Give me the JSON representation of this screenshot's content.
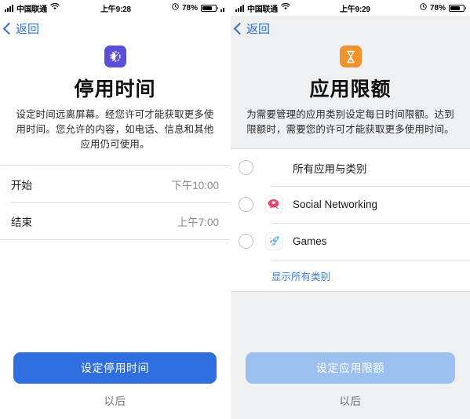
{
  "left": {
    "statusbar": {
      "carrier": "中国联通",
      "time": "上午9:28",
      "battery_pct": "78%",
      "signal_icon": "cellular-signal-icon",
      "wifi_icon": "wifi-icon",
      "alarm_icon": "alarm-clock-icon",
      "battery_icon": "battery-icon"
    },
    "nav": {
      "back_label": "返回",
      "back_icon": "chevron-left-icon"
    },
    "hero": {
      "icon_name": "downtime-icon",
      "icon_color": "#5a4fd6",
      "title": "停用时间",
      "description": "设定时间远离屏幕。经您许可才能获取更多使用时间。您允许的内容，如电话、信息和其他应用仍可使用。"
    },
    "rows": [
      {
        "label": "开始",
        "value": "下午10:00"
      },
      {
        "label": "结束",
        "value": "上午7:00"
      }
    ],
    "footer": {
      "primary_label": "设定停用时间",
      "primary_color": "#2f6fe0",
      "secondary_label": "以后"
    }
  },
  "right": {
    "statusbar": {
      "carrier": "中国联通",
      "time": "上午9:29",
      "battery_pct": "78%",
      "signal_icon": "cellular-signal-icon",
      "wifi_icon": "wifi-icon",
      "alarm_icon": "alarm-clock-icon",
      "battery_icon": "battery-icon"
    },
    "nav": {
      "back_label": "返回",
      "back_icon": "chevron-left-icon"
    },
    "hero": {
      "icon_name": "hourglass-icon",
      "icon_color": "#f0922e",
      "title": "应用限额",
      "description": "为需要管理的应用类别设定每日时间限额。达到限额时，需要您的许可才能获取更多使用时间。"
    },
    "options": [
      {
        "label": "所有应用与类别",
        "icon_name": "none",
        "selected": false
      },
      {
        "label": "Social Networking",
        "icon_name": "social-networking-icon",
        "selected": false
      },
      {
        "label": "Games",
        "icon_name": "games-rocket-icon",
        "selected": false
      }
    ],
    "show_all_label": "显示所有类别",
    "footer": {
      "primary_label": "设定应用限额",
      "primary_color": "#9cc0ef",
      "secondary_label": "以后"
    }
  }
}
